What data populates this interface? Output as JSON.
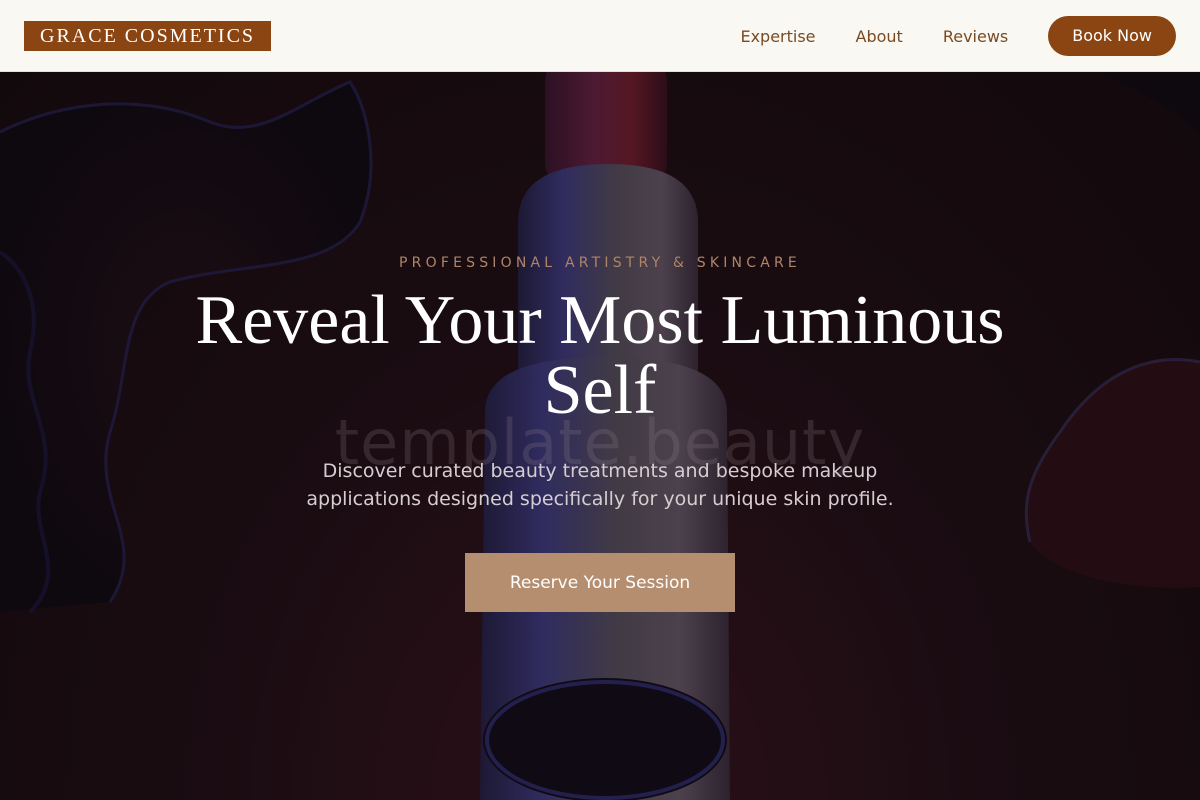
{
  "brand": {
    "logo_text": "GRACE COSMETICS"
  },
  "nav": {
    "links": [
      "Expertise",
      "About",
      "Reviews"
    ],
    "book_label": "Book Now"
  },
  "hero": {
    "eyebrow": "PROFESSIONAL ARTISTRY & SKINCARE",
    "title": "Reveal Your Most Luminous Self",
    "watermark": "template.beauty",
    "subtitle": "Discover curated beauty treatments and bespoke makeup applications designed specifically for your unique skin profile.",
    "cta_label": "Reserve Your Session"
  },
  "colors": {
    "brand": "#8b4513",
    "nav_background": "#f9f8f3",
    "nav_link": "#7a4a22",
    "cta": "#b58e70",
    "eyebrow": "#b08468"
  }
}
